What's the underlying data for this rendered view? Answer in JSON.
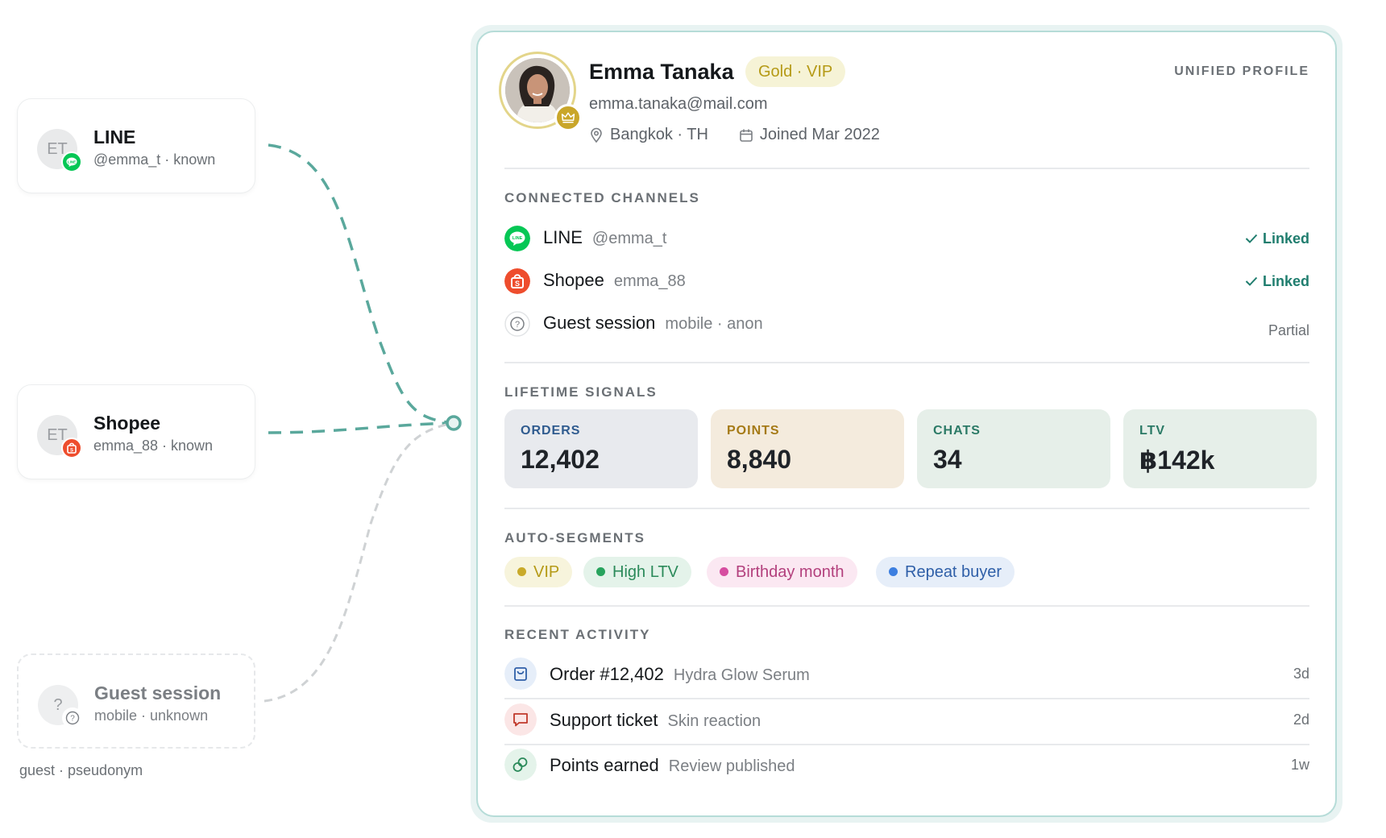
{
  "sources": [
    {
      "initials": "ET",
      "title": "LINE",
      "sub": "@emma_t · known",
      "badge_icon": "line-icon",
      "badge_color": "#06c755"
    },
    {
      "initials": "ET",
      "title": "Shopee",
      "sub": "emma_88 · known",
      "badge_icon": "shopee-icon",
      "badge_color": "#ee4d2d"
    },
    {
      "initials": "?",
      "title": "Guest session",
      "sub": "mobile · unknown",
      "badge_icon": "question-icon",
      "badge_color": "#ffffff"
    }
  ],
  "guest_caption": "guest · pseudonym",
  "profile": {
    "name": "Emma Tanaka",
    "tier": "Gold · VIP",
    "email": "emma.tanaka@mail.com",
    "location": "Bangkok · TH",
    "joined": "Joined Mar 2022",
    "header_label": "UNIFIED PROFILE"
  },
  "channels": {
    "title": "CONNECTED CHANNELS",
    "items": [
      {
        "name": "LINE",
        "handle": "@emma_t",
        "status": "Linked"
      },
      {
        "name": "Shopee",
        "handle": "emma_88",
        "status": "Linked"
      },
      {
        "name": "Guest session",
        "handle": "mobile · anon",
        "status": "Partial"
      }
    ]
  },
  "signals": {
    "title": "LIFETIME SIGNALS",
    "tiles": [
      {
        "label": "ORDERS",
        "value": "12,402",
        "bg": "#e8eaee",
        "fg": "#2f5b8f"
      },
      {
        "label": "POINTS",
        "value": "8,840",
        "bg": "#f4ebdd",
        "fg": "#a57a16"
      },
      {
        "label": "CHATS",
        "value": "34",
        "bg": "#e6efe9",
        "fg": "#2b7a66"
      },
      {
        "label": "LTV",
        "value": "฿142k",
        "bg": "#e6efe9",
        "fg": "#2b7a66"
      }
    ]
  },
  "segments": {
    "title": "AUTO-SEGMENTS",
    "items": [
      {
        "label": "VIP",
        "bg": "#f7f4dc",
        "fg": "#b59a16",
        "dot": "#c9aa2a"
      },
      {
        "label": "High LTV",
        "bg": "#e4f3ea",
        "fg": "#2b8a5a",
        "dot": "#27a35d"
      },
      {
        "label": "Birthday month",
        "bg": "#fbe8f2",
        "fg": "#b3407d",
        "dot": "#d64da0"
      },
      {
        "label": "Repeat buyer",
        "bg": "#e6eef9",
        "fg": "#2f5fa8",
        "dot": "#3d7fe0"
      }
    ]
  },
  "activity": {
    "title": "RECENT ACTIVITY",
    "items": [
      {
        "title": "Order #12,402",
        "desc": "Hydra Glow Serum",
        "time": "3d",
        "icon": "bag-icon"
      },
      {
        "title": "Support ticket",
        "desc": "Skin reaction",
        "time": "2d",
        "icon": "chat-icon"
      },
      {
        "title": "Points earned",
        "desc": "Review published",
        "time": "1w",
        "icon": "coins-icon"
      }
    ]
  }
}
